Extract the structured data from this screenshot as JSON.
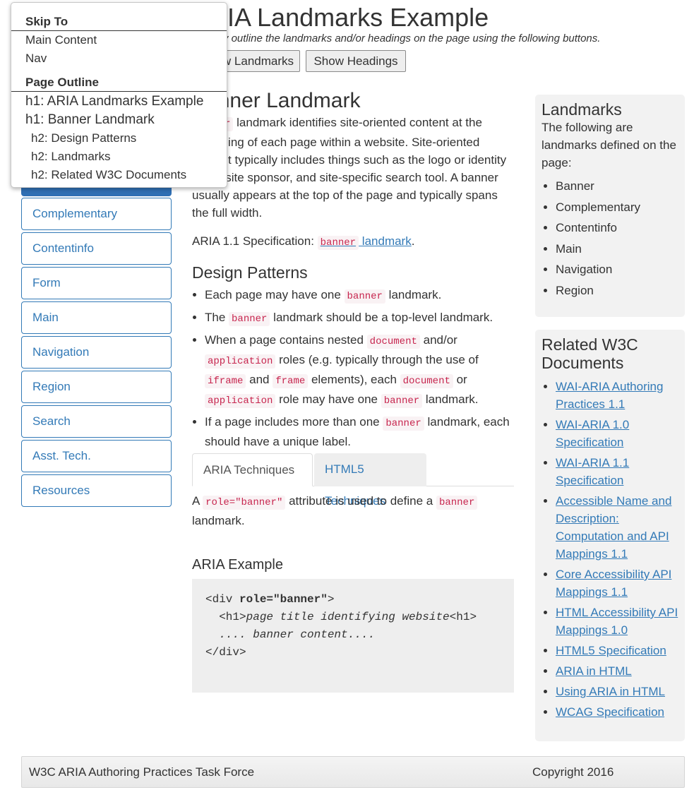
{
  "page": {
    "title": "ARIA Landmarks Example",
    "intro": "Visually outline the landmarks and/or headings on the page using the following buttons.",
    "buttons": {
      "show_landmarks": "Show Landmarks",
      "show_headings": "Show Headings"
    }
  },
  "nav": {
    "items": [
      {
        "label": "Complementary"
      },
      {
        "label": "Contentinfo"
      },
      {
        "label": "Form"
      },
      {
        "label": "Main"
      },
      {
        "label": "Navigation"
      },
      {
        "label": "Region"
      },
      {
        "label": "Search"
      },
      {
        "label": "Asst. Tech."
      },
      {
        "label": "Resources"
      }
    ]
  },
  "skipto": {
    "skip_label": "Skip To",
    "skip_items": [
      "Main Content",
      "Nav"
    ],
    "outline_label": "Page Outline",
    "outline_items": [
      {
        "label": "h1: ARIA Landmarks Example",
        "level": 1
      },
      {
        "label": "h1: Banner Landmark",
        "level": 1
      },
      {
        "label": "h2: Design Patterns",
        "level": 2
      },
      {
        "label": "h2: Landmarks",
        "level": 2
      },
      {
        "label": "h2: Related W3C Documents",
        "level": 2
      }
    ]
  },
  "main": {
    "heading": "Banner Landmark",
    "intro": {
      "code": "banner",
      "text": " landmark identifies site-oriented content at the beginning of each page within a website. Site-oriented content typically includes things such as the logo or identity of the site sponsor, and site-specific search tool. A banner usually appears at the top of the page and typically spans the full width."
    },
    "spec": {
      "prefix": "ARIA 1.1 Specification: ",
      "code": "banner",
      "link": " landmark",
      "suffix": "."
    },
    "design_heading": "Design Patterns",
    "design_items": [
      {
        "t1": "Each page may have one ",
        "c1": "banner",
        "t2": " landmark."
      },
      {
        "t1": "The ",
        "c1": "banner",
        "t2": " landmark should be a top-level landmark."
      },
      {
        "t1": "When a page contains nested ",
        "c1": "document",
        "t2": " and/or ",
        "c2": "application",
        "t3": " roles (e.g. typically through the use of ",
        "c3": "iframe",
        "t4": " and ",
        "c4": "frame",
        "t5": " elements), each ",
        "c5": "document",
        "t6": " or ",
        "c6": "application",
        "t7": " role may have one ",
        "c7": "banner",
        "t8": " landmark."
      },
      {
        "t1": "If a page includes more than one ",
        "c1": "banner",
        "t2": " landmark, each should have a unique label."
      }
    ],
    "tabs": {
      "aria": "ARIA Techniques",
      "html5": "HTML5 Techniques"
    },
    "tab_panel": {
      "t1": "A ",
      "c1": "role=\"banner\"",
      "t2": " attribute is used to define a ",
      "c2": "banner",
      "t3": " landmark."
    },
    "example_heading": "ARIA Example",
    "code_example": {
      "open_tag": "<div ",
      "attr": "role=\"banner\"",
      "open_close": ">",
      "h1_open": "  <h1>",
      "h1_text": "page title identifying website",
      "h1_close": "<h1>",
      "content": "  .... banner content....",
      "close_tag": "</div>"
    }
  },
  "sidebar": {
    "landmarks": {
      "heading": "Landmarks",
      "text": "The following are landmarks defined on the page:",
      "items": [
        "Banner",
        "Complementary",
        "Contentinfo",
        "Main",
        "Navigation",
        "Region"
      ]
    },
    "related": {
      "heading": "Related W3C Documents",
      "links": [
        "WAI-ARIA Authoring Practices 1.1",
        "WAI-ARIA 1.0 Specification",
        "WAI-ARIA 1.1 Specification",
        "Accessible Name and Description: Computation and API Mappings 1.1",
        "Core Accessibility API Mappings 1.1",
        "HTML Accessibility API Mappings 1.0",
        "HTML5 Specification",
        "ARIA in HTML",
        "Using ARIA in HTML",
        "WCAG Specification"
      ]
    }
  },
  "footer": {
    "left": "W3C ARIA Authoring Practices Task Force",
    "right": "Copyright 2016"
  },
  "colors": {
    "link": "#337ab7",
    "code": "#c7254e",
    "code_bg": "#f9f2f4",
    "nav_active": "#2f6fb4"
  }
}
